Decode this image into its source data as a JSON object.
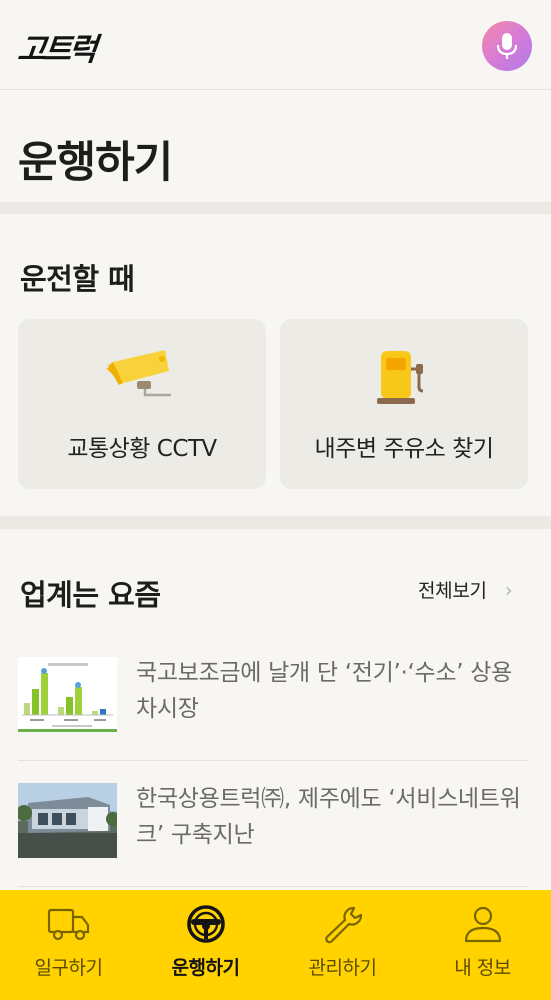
{
  "header": {
    "logo_text": "고트럭",
    "mic_icon": "microphone-icon"
  },
  "page": {
    "title": "운행하기"
  },
  "driving": {
    "section_title": "운전할 때",
    "cards": [
      {
        "label": "교통상황 CCTV",
        "icon": "cctv-camera-icon"
      },
      {
        "label": "내주변 주유소 찾기",
        "icon": "gas-station-icon"
      }
    ]
  },
  "news": {
    "section_title": "업계는 요즘",
    "view_all_label": "전체보기",
    "items": [
      {
        "title": "국고보조금에 날개 단 ‘전기’·‘수소’ 상용차시장"
      },
      {
        "title": "한국상용트럭㈜, 제주에도 ‘서비스네트워크’ 구축지난"
      }
    ]
  },
  "bottom_nav": {
    "items": [
      {
        "label": "일구하기",
        "icon": "truck-icon",
        "active": false
      },
      {
        "label": "운행하기",
        "icon": "steering-wheel-icon",
        "active": true
      },
      {
        "label": "관리하기",
        "icon": "wrench-icon",
        "active": false
      },
      {
        "label": "내 정보",
        "icon": "user-icon",
        "active": false
      }
    ]
  },
  "colors": {
    "background": "#f7f6f2",
    "card": "#ecebe6",
    "nav_bar": "#ffd200",
    "accent_yellow": "#f7c71a"
  }
}
